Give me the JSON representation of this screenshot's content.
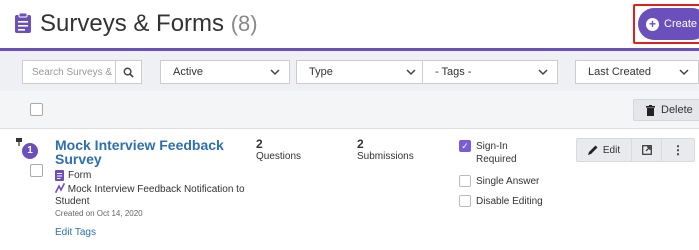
{
  "header": {
    "title": "Surveys & Forms",
    "count": "(8)",
    "create_label": "Create"
  },
  "filters": {
    "search_placeholder": "Search Surveys &",
    "status": "Active",
    "type": "Type",
    "tags": "- Tags -",
    "sort": "Last Created"
  },
  "bulk": {
    "delete_label": "Delete"
  },
  "items": [
    {
      "number": "1",
      "title": "Mock Interview Feedback Survey",
      "type_label": "Form",
      "notification": "Mock Interview Feedback Notification to Student",
      "created": "Created on Oct 14, 2020",
      "edit_tags": "Edit Tags",
      "questions_count": "2",
      "questions_label": "Questions",
      "submissions_count": "2",
      "submissions_label": "Submissions",
      "options": [
        {
          "label": "Sign-In Required",
          "checked": true
        },
        {
          "label": "Single Answer",
          "checked": false
        },
        {
          "label": "Disable Editing",
          "checked": false
        }
      ],
      "edit_label": "Edit",
      "more_label": "⋮"
    }
  ],
  "colors": {
    "accent": "#6b4fbb",
    "link": "#2e6fb0",
    "highlight": "#e02020"
  },
  "icons": [
    "clipboard-icon",
    "plus-icon",
    "search-icon",
    "chevron-down-icon",
    "trash-icon",
    "pin-icon",
    "form-icon",
    "notification-icon",
    "pencil-icon",
    "external-link-icon",
    "more-icon"
  ]
}
